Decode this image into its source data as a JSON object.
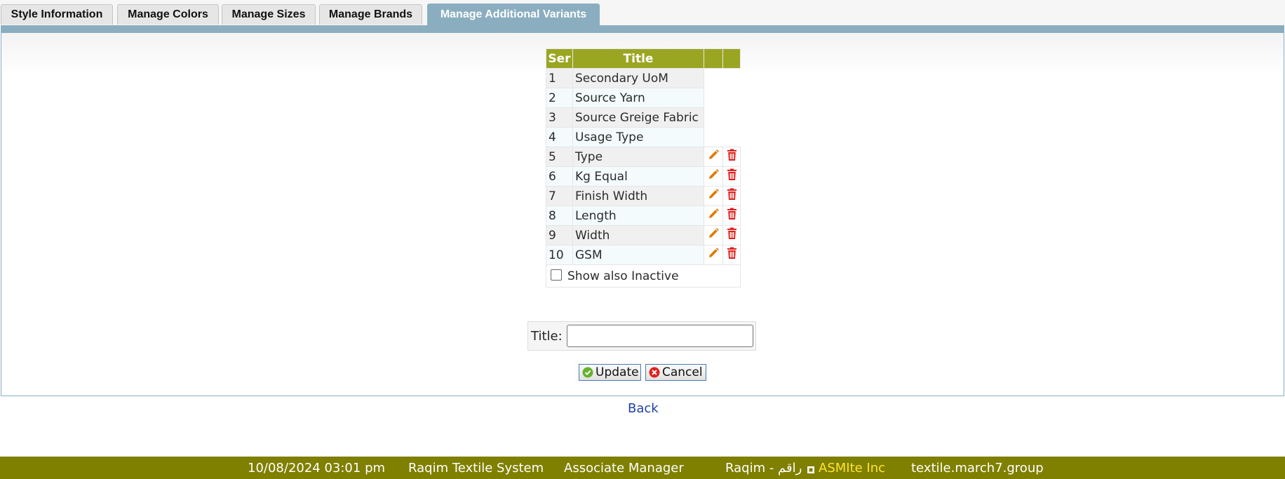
{
  "tabs": [
    {
      "label": "Style Information",
      "active": false
    },
    {
      "label": "Manage Colors",
      "active": false
    },
    {
      "label": "Manage Sizes",
      "active": false
    },
    {
      "label": "Manage Brands",
      "active": false
    },
    {
      "label": "Manage Additional Variants",
      "active": true
    }
  ],
  "grid": {
    "headers": {
      "ser": "Ser",
      "title": "Title"
    },
    "rows": [
      {
        "ser": "1",
        "title": "Secondary UoM",
        "editable": false
      },
      {
        "ser": "2",
        "title": "Source Yarn",
        "editable": false
      },
      {
        "ser": "3",
        "title": "Source Greige Fabric",
        "editable": false
      },
      {
        "ser": "4",
        "title": "Usage Type",
        "editable": false
      },
      {
        "ser": "5",
        "title": "Type",
        "editable": true
      },
      {
        "ser": "6",
        "title": "Kg Equal",
        "editable": true
      },
      {
        "ser": "7",
        "title": "Finish Width",
        "editable": true
      },
      {
        "ser": "8",
        "title": "Length",
        "editable": true
      },
      {
        "ser": "9",
        "title": "Width",
        "editable": true
      },
      {
        "ser": "10",
        "title": "GSM",
        "editable": true
      }
    ],
    "show_inactive_label": "Show also Inactive",
    "show_inactive_checked": false
  },
  "form": {
    "title_label": "Title:",
    "title_value": ""
  },
  "buttons": {
    "update_label": "Update",
    "cancel_label": "Cancel"
  },
  "back_label": "Back",
  "footer": {
    "datetime": "10/08/2024 03:01 pm",
    "system": "Raqim Textile System",
    "role": "Associate Manager",
    "brand": "Raqim - راقم",
    "company": "ASMIte Inc",
    "domain": "textile.march7.group"
  },
  "colors": {
    "tab_active": "#8aaec0",
    "grid_header": "#9aa622",
    "footer_bg": "#7f7f00",
    "company_text": "#ffe52e",
    "edit_icon": "#e07a00",
    "delete_icon": "#e0201c",
    "link": "#1d3fa8"
  }
}
